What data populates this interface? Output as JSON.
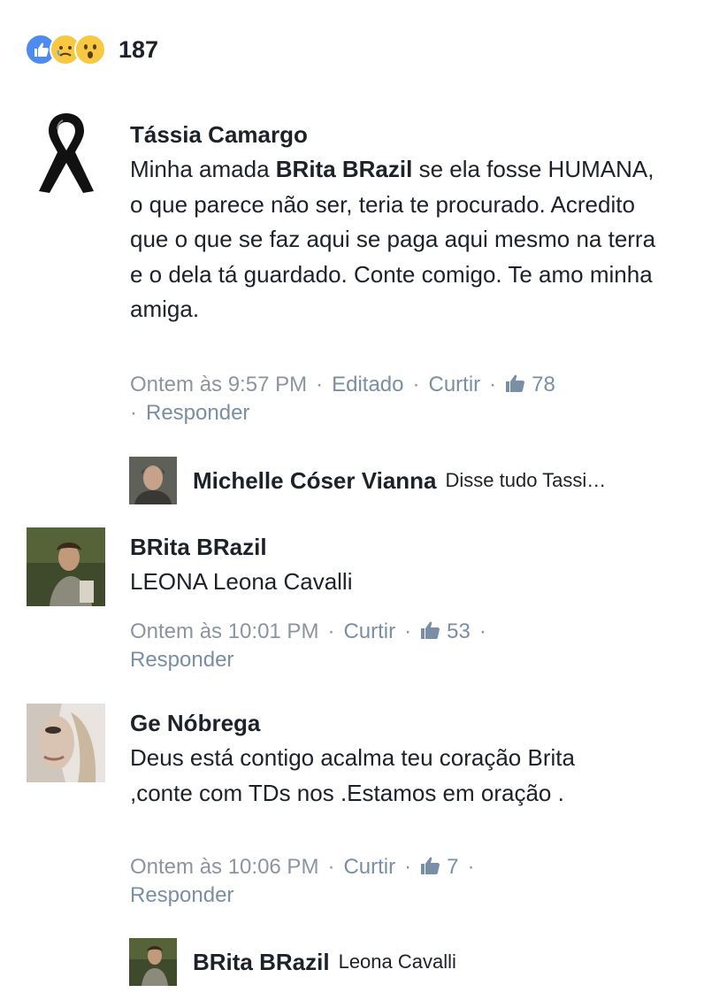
{
  "reactions": {
    "icons": [
      "like-icon",
      "sad-icon",
      "wow-icon"
    ],
    "count": "187",
    "colors": {
      "like": "#4d8bf0",
      "emoji": "#f7c842"
    }
  },
  "comments": [
    {
      "author": "Tássia Camargo",
      "avatar": "black-ribbon-icon",
      "text_intro": "Minha amada ",
      "text_mention": "BRita BRazil",
      "text_rest": " se ela fosse HUMANA, o que parece não ser, teria te procurado. Acredito que o que se faz aqui se paga aqui mesmo na terra e o dela tá guardado. Conte comigo.  Te amo minha amiga.",
      "time": "Ontem às 9:57 PM",
      "edited": "Editado",
      "like_label": "Curtir",
      "like_count": "78",
      "reply_label": "Responder",
      "reply": {
        "author": "Michelle Cóser Vianna",
        "text": "Disse tudo Tassi…"
      }
    },
    {
      "author": "BRita BRazil",
      "text": "LEONA Leona Cavalli",
      "time": "Ontem às 10:01 PM",
      "like_label": "Curtir",
      "like_count": "53",
      "reply_label": "Responder"
    },
    {
      "author": "Ge Nóbrega",
      "text": "Deus está contigo acalma teu coração Brita  ,conte com TDs nos .Estamos em oração .",
      "time": "Ontem às 10:06 PM",
      "like_label": "Curtir",
      "like_count": "7",
      "reply_label": "Responder",
      "reply": {
        "author": "BRita BRazil",
        "text": "Leona Cavalli"
      }
    }
  ]
}
